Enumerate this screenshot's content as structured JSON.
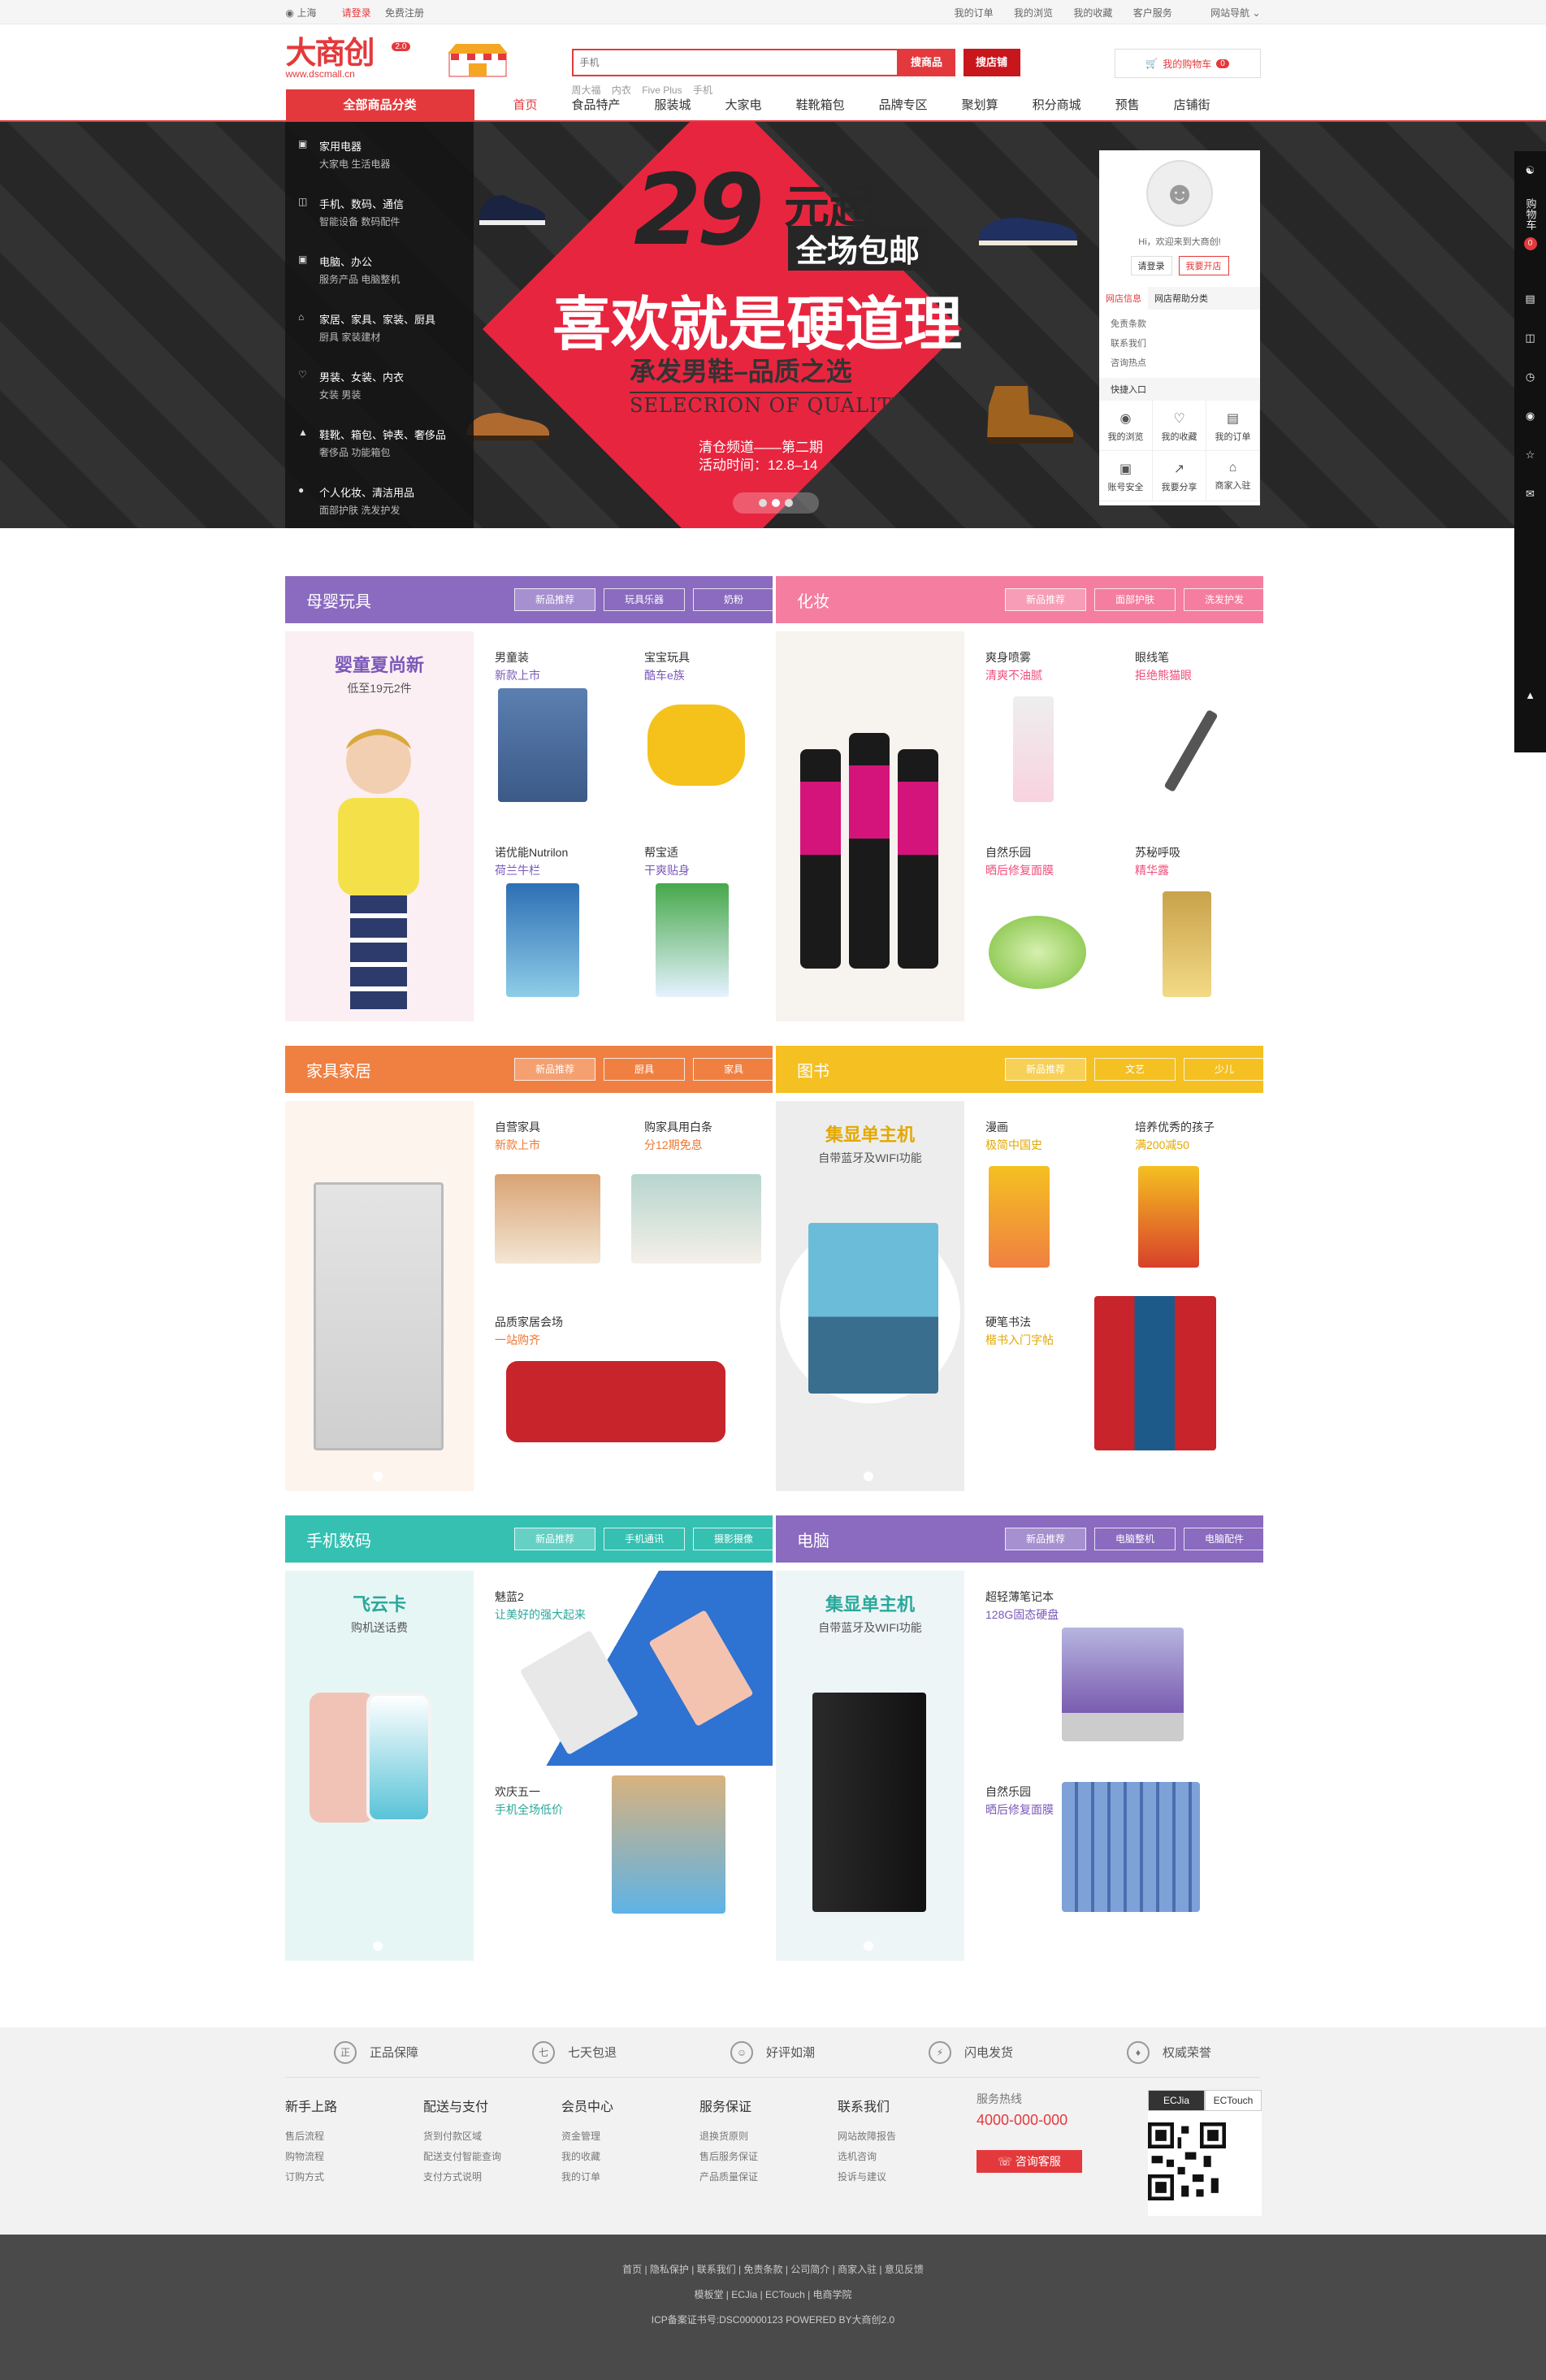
{
  "topbar": {
    "location": "上海",
    "login": "请登录",
    "register": "免费注册",
    "links": [
      "我的订单",
      "我的浏览",
      "我的收藏",
      "客户服务",
      "网站导航"
    ]
  },
  "logo": {
    "name": "大商创",
    "version": "2.0",
    "url": "www.dscmall.cn"
  },
  "search": {
    "placeholder": "手机",
    "btn_goods": "搜商品",
    "btn_shop": "搜店铺",
    "hot": [
      "周大福",
      "内衣",
      "Five Plus",
      "手机"
    ]
  },
  "cart": {
    "label": "我的购物车",
    "count": "0"
  },
  "nav": {
    "all": "全部商品分类",
    "links": [
      "首页",
      "食品特产",
      "服装城",
      "大家电",
      "鞋靴箱包",
      "品牌专区",
      "聚划算",
      "积分商城",
      "预售",
      "店铺街"
    ]
  },
  "categories": [
    {
      "title": "家用电器",
      "sub": "大家电  生活电器"
    },
    {
      "title": "手机、数码、通信",
      "sub": "智能设备  数码配件"
    },
    {
      "title": "电脑、办公",
      "sub": "服务产品  电脑整机"
    },
    {
      "title": "家居、家具、家装、厨具",
      "sub": "厨具  家装建材"
    },
    {
      "title": "男装、女装、内衣",
      "sub": "女装  男装"
    },
    {
      "title": "鞋靴、箱包、钟表、奢侈品",
      "sub": "奢侈品  功能箱包"
    },
    {
      "title": "个人化妆、清洁用品",
      "sub": "面部护肤  洗发护发"
    }
  ],
  "banner": {
    "big": "29",
    "yuan": "元起",
    "baoyou": "全场包邮",
    "slogan": "喜欢就是硬道理",
    "sub": "承发男鞋–品质之选",
    "en": "SELECRION OF QUALITY",
    "note1": "清仓频道——第二期",
    "note2": "活动时间：12.8–14"
  },
  "user": {
    "hi": "Hi，欢迎来到大商创!",
    "login": "请登录",
    "open": "我要开店",
    "tabs": [
      "网店信息",
      "网店帮助分类"
    ],
    "list": [
      "免责条款",
      "联系我们",
      "咨询热点"
    ],
    "quick": "快捷入口",
    "quicklinks": [
      "我的浏览",
      "我的收藏",
      "我的订单",
      "账号安全",
      "我要分享",
      "商家入驻"
    ]
  },
  "floors": [
    {
      "title": "母婴玩具",
      "color": "#8a6bbf",
      "tabs": [
        "新品推荐",
        "玩具乐器",
        "奶粉"
      ],
      "left_title": "婴童夏尚新",
      "left_sub": "低至19元2件",
      "left_color": "#7b58b9",
      "cells": [
        {
          "n": "男童装",
          "d": "新款上市"
        },
        {
          "n": "宝宝玩具",
          "d": "酷车e族"
        },
        {
          "n": "诺优能Nutrilon",
          "d": "荷兰牛栏"
        },
        {
          "n": "帮宝适",
          "d": "干爽贴身"
        }
      ],
      "accent": "#7b58b9"
    },
    {
      "title": "化妆",
      "color": "#f47da0",
      "tabs": [
        "新品推荐",
        "面部护肤",
        "洗发护发"
      ],
      "left_title": "",
      "left_sub": "",
      "left_color": "#f47da0",
      "cells": [
        {
          "n": "爽身喷雾",
          "d": "清爽不油腻"
        },
        {
          "n": "眼线笔",
          "d": "拒绝熊猫眼"
        },
        {
          "n": "自然乐园",
          "d": "晒后修复面膜"
        },
        {
          "n": "苏秘呼吸",
          "d": "精华露"
        }
      ],
      "accent": "#f04d7b"
    },
    {
      "title": "家具家居",
      "color": "#f08042",
      "tabs": [
        "新品推荐",
        "厨具",
        "家具"
      ],
      "left_title": "",
      "left_sub": "",
      "left_color": "#f08042",
      "cells": [
        {
          "n": "自营家具",
          "d": "新款上市"
        },
        {
          "n": "购家具用白条",
          "d": "分12期免息"
        },
        {
          "n": "品质家居会场",
          "d": "一站购齐"
        },
        {
          "n": "",
          "d": ""
        }
      ],
      "accent": "#f0762f"
    },
    {
      "title": "图书",
      "color": "#f5c021",
      "tabs": [
        "新品推荐",
        "文艺",
        "少儿"
      ],
      "left_title": "集显单主机",
      "left_sub": "自带蓝牙及WIFI功能",
      "left_color": "#e3a800",
      "cells": [
        {
          "n": "漫画",
          "d": "极简中国史"
        },
        {
          "n": "培养优秀的孩子",
          "d": "满200减50"
        },
        {
          "n": "硬笔书法",
          "d": "楷书入门字帖"
        },
        {
          "n": "",
          "d": ""
        }
      ],
      "accent": "#e3a800"
    },
    {
      "title": "手机数码",
      "color": "#35c0b2",
      "tabs": [
        "新品推荐",
        "手机通讯",
        "摄影摄像"
      ],
      "left_title": "飞云卡",
      "left_sub": "购机送话费",
      "left_color": "#2aa89b",
      "cells": [
        {
          "n": "魅蓝2",
          "d": "让美好的强大起来"
        },
        {
          "n": "",
          "d": ""
        },
        {
          "n": "欢庆五一",
          "d": "手机全场低价"
        },
        {
          "n": "",
          "d": ""
        }
      ],
      "accent": "#2aa89b"
    },
    {
      "title": "电脑",
      "color": "#8a6bbf",
      "tabs": [
        "新品推荐",
        "电脑整机",
        "电脑配件"
      ],
      "left_title": "集显单主机",
      "left_sub": "自带蓝牙及WIFI功能",
      "left_color": "#2aa89b",
      "cells": [
        {
          "n": "超轻薄笔记本",
          "d": "128G固态硬盘"
        },
        {
          "n": "",
          "d": ""
        },
        {
          "n": "自然乐园",
          "d": "晒后修复面膜"
        },
        {
          "n": "",
          "d": ""
        }
      ],
      "accent": "#7b58b9"
    }
  ],
  "services": [
    "正品保障",
    "七天包退",
    "好评如潮",
    "闪电发货",
    "权威荣誉"
  ],
  "footcols": [
    {
      "h": "新手上路",
      "items": [
        "售后流程",
        "购物流程",
        "订购方式"
      ]
    },
    {
      "h": "配送与支付",
      "items": [
        "货到付款区域",
        "配送支付智能查询",
        "支付方式说明"
      ]
    },
    {
      "h": "会员中心",
      "items": [
        "资金管理",
        "我的收藏",
        "我的订单"
      ]
    },
    {
      "h": "服务保证",
      "items": [
        "退换货原则",
        "售后服务保证",
        "产品质量保证"
      ]
    },
    {
      "h": "联系我们",
      "items": [
        "网站故障报告",
        "选机咨询",
        "投诉与建议"
      ]
    }
  ],
  "hotline": {
    "label": "服务热线",
    "number": "4000-000-000",
    "kf": "咨询客服"
  },
  "qr": {
    "tabs": [
      "ECJia",
      "ECTouch"
    ]
  },
  "footer": {
    "links": "首页 | 隐私保护 | 联系我们 | 免责条款 | 公司简介 | 商家入驻 | 意见反馈",
    "links2": "模板堂 | ECJia | ECTouch | 电商学院",
    "icp": "ICP备案证书号:DSC00000123 POWERED BY大商创2.0"
  },
  "rail": {
    "cart": "购物车",
    "count": "0"
  }
}
